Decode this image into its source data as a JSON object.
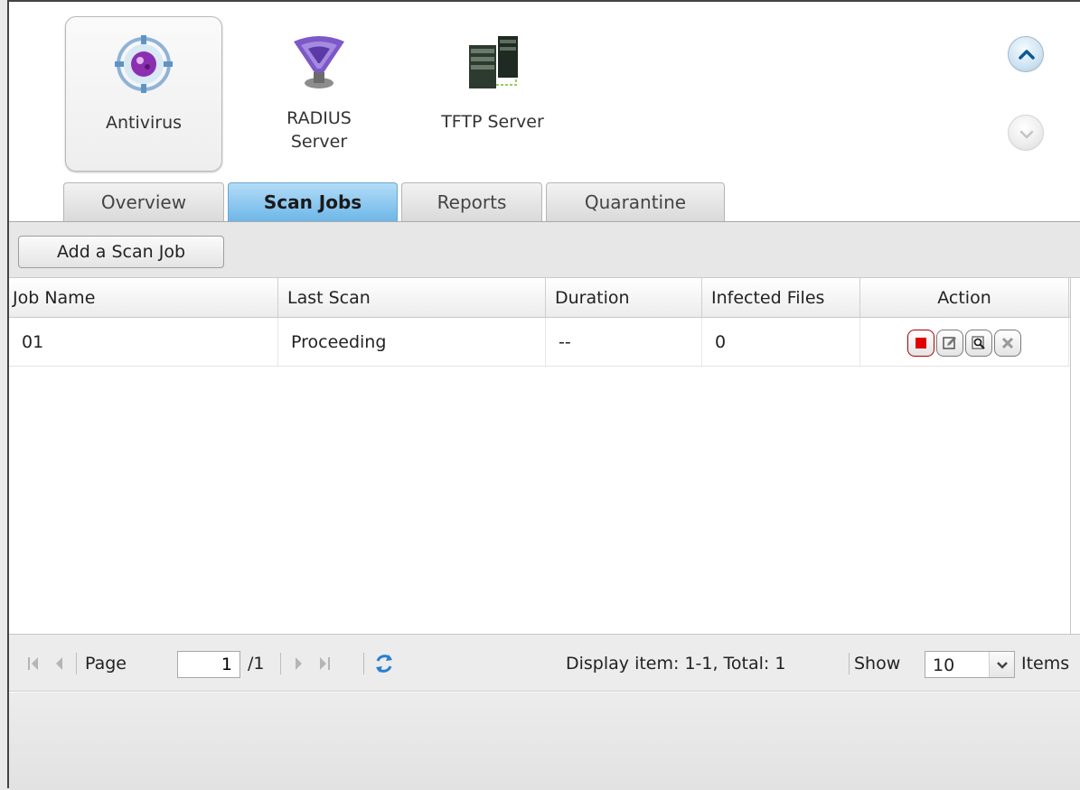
{
  "apps": [
    {
      "label": "Antivirus",
      "icon": "antivirus-icon",
      "selected": true
    },
    {
      "label": "RADIUS Server",
      "icon": "radius-server-icon",
      "selected": false
    },
    {
      "label": "TFTP Server",
      "icon": "tftp-server-icon",
      "selected": false
    }
  ],
  "scroll": {
    "up_icon": "chevron-up-icon",
    "down_icon": "chevron-down-icon"
  },
  "tabs": [
    {
      "label": "Overview"
    },
    {
      "label": "Scan Jobs",
      "active": true
    },
    {
      "label": "Reports"
    },
    {
      "label": "Quarantine"
    }
  ],
  "toolbar": {
    "add_label": "Add a Scan Job"
  },
  "grid": {
    "columns": [
      "Job Name",
      "Last Scan",
      "Duration",
      "Infected Files",
      "Action"
    ],
    "rows": [
      {
        "job_name": "01",
        "last_scan": "Proceeding",
        "duration": "--",
        "infected": "0",
        "actions": [
          "stop-icon",
          "edit-icon",
          "view-log-icon",
          "delete-icon"
        ]
      }
    ]
  },
  "pager": {
    "page_label": "Page",
    "page_value": "1",
    "total_pages": "/1",
    "display_text": "Display item: 1-1, Total: 1",
    "show_label": "Show",
    "show_value": "10",
    "items_label": "Items"
  },
  "colors": {
    "active_tab": "#6cb6e8",
    "stop_red": "#e00000",
    "refresh_blue": "#2a7fd0"
  }
}
